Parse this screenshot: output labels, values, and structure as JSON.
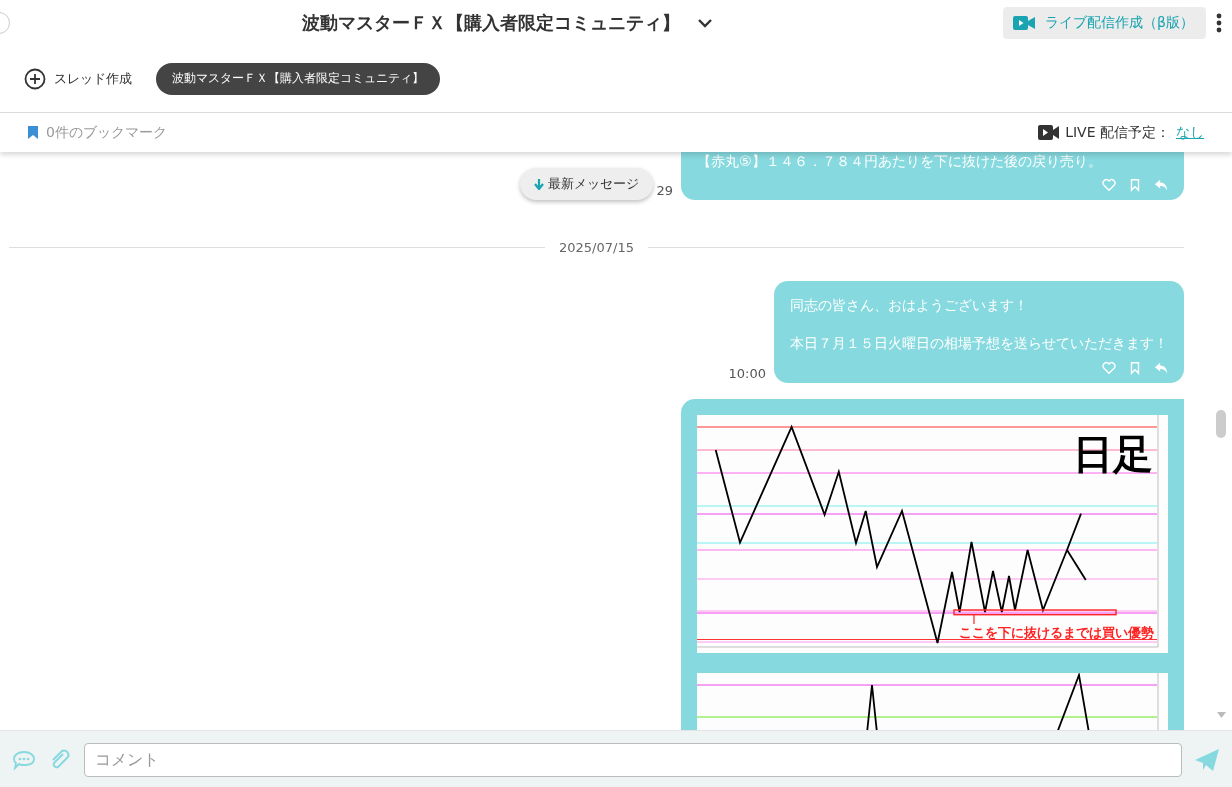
{
  "header": {
    "title": "波動マスターＦＸ【購入者限定コミュニティ】",
    "live_button": "ライブ配信作成（β版）"
  },
  "threads": {
    "create": "スレッド作成",
    "items": [
      {
        "label": "波動マスターＦＸ【購入者限定コミュニティ】",
        "selected": true
      }
    ]
  },
  "bookmark_bar": {
    "bookmarks": "0件のブックマーク",
    "live_schedule_label": "LIVE 配信予定：",
    "live_schedule_link": "なし"
  },
  "jump_button": "最新メッセージ",
  "messages": [
    {
      "kind": "text",
      "paragraphs": [
        "【赤丸⑤】１４６．７８４円あたりを下に抜けた後の戻り売り。"
      ],
      "time": "29"
    },
    {
      "kind": "date",
      "label": "2025/07/15"
    },
    {
      "kind": "text",
      "paragraphs": [
        "同志の皆さん、おはようございます！",
        "本日７月１５日火曜日の相場予想を送らせていただきます！"
      ],
      "time": "10:00"
    },
    {
      "kind": "images",
      "images": [
        {
          "kind": "annotated",
          "caption": "日足",
          "note": "ここを下に抜けるまでは買い優勢"
        },
        {
          "kind": "plain"
        }
      ]
    }
  ],
  "composer": {
    "placeholder": "コメント"
  }
}
